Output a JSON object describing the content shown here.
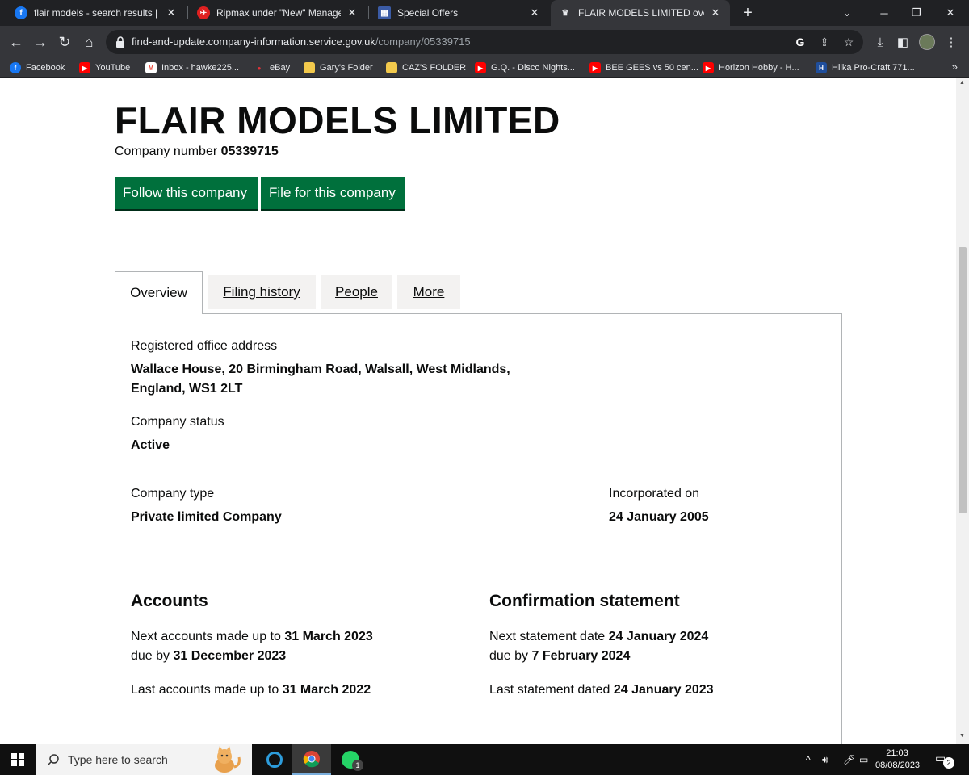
{
  "browser": {
    "tabs": [
      {
        "title": "flair models - search results | Face",
        "icon": "facebook-icon",
        "color": "#1877f2"
      },
      {
        "title": "Ripmax under \"New\" Manageme",
        "icon": "ripmax-icon",
        "color": "#e02020"
      },
      {
        "title": "Special Offers",
        "icon": "shop-icon",
        "color": "#3b5ba5"
      },
      {
        "title": "FLAIR MODELS LIMITED overview",
        "icon": "crown-icon",
        "color": "#ffffff",
        "active": true
      }
    ],
    "url_host": "find-and-update.company-information.service.gov.uk",
    "url_path": "/company/05339715",
    "bookmarks": [
      {
        "label": "Facebook",
        "icon": "facebook-icon",
        "color": "#1877f2"
      },
      {
        "label": "YouTube",
        "icon": "youtube-icon",
        "color": "#ff0000"
      },
      {
        "label": "Inbox - hawke225...",
        "icon": "gmail-icon",
        "color": "#ea4335"
      },
      {
        "label": "eBay",
        "icon": "ebay-icon",
        "color": "#e53238"
      },
      {
        "label": "Gary's Folder",
        "icon": "folder-icon",
        "color": "#f2c94c"
      },
      {
        "label": "CAZ'S FOLDER",
        "icon": "folder-icon",
        "color": "#f2c94c"
      },
      {
        "label": "G.Q. - Disco Nights...",
        "icon": "youtube-icon",
        "color": "#ff0000"
      },
      {
        "label": "BEE GEES vs 50 cen...",
        "icon": "youtube-icon",
        "color": "#ff0000"
      },
      {
        "label": "Horizon Hobby - H...",
        "icon": "youtube-icon",
        "color": "#ff0000"
      },
      {
        "label": "Hilka Pro-Craft 771...",
        "icon": "hilka-icon",
        "color": "#1f4e9c"
      }
    ],
    "more_bookmarks": "»"
  },
  "company": {
    "name": "FLAIR MODELS LIMITED",
    "number_label": "Company number",
    "number": "05339715",
    "follow_label": "Follow this company",
    "file_label": "File for this company"
  },
  "tabs": [
    "Overview",
    "Filing history",
    "People",
    "More"
  ],
  "overview": {
    "address_label": "Registered office address",
    "address_line1": "Wallace House, 20 Birmingham Road, Walsall, West Midlands,",
    "address_line2": "England, WS1 2LT",
    "status_label": "Company status",
    "status": "Active",
    "type_label": "Company type",
    "type": "Private limited Company",
    "incorporated_label": "Incorporated on",
    "incorporated": "24 January 2005"
  },
  "accounts": {
    "heading": "Accounts",
    "next_prefix": "Next accounts made up to",
    "next_date": "31 March 2023",
    "due_prefix": "due by",
    "due_date": "31 December 2023",
    "last_prefix": "Last accounts made up to",
    "last_date": "31 March 2022"
  },
  "confirmation": {
    "heading": "Confirmation statement",
    "next_prefix": "Next statement date",
    "next_date": "24 January 2024",
    "due_prefix": "due by",
    "due_date": "7 February 2024",
    "last_prefix": "Last statement dated",
    "last_date": "24 January 2023"
  },
  "taskbar": {
    "search_placeholder": "Type here to search",
    "whatsapp_badge": "1",
    "time": "21:03",
    "date": "08/08/2023",
    "notification_count": "2"
  }
}
